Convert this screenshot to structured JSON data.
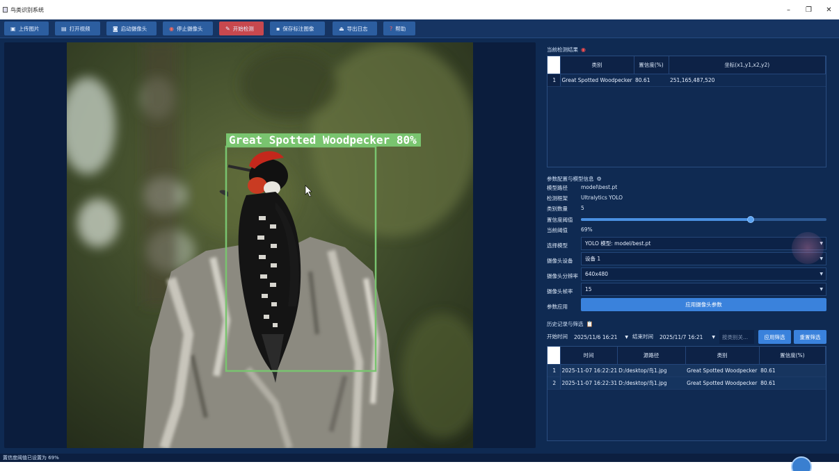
{
  "window": {
    "title": "鸟类识别系统",
    "controls": {
      "minimize": "–",
      "maximize": "❐",
      "close": "✕"
    }
  },
  "toolbar": {
    "buttons": [
      {
        "icon": "image-icon",
        "glyph": "▣",
        "label": "上传图片"
      },
      {
        "icon": "video-icon",
        "glyph": "▤",
        "label": "打开视频"
      },
      {
        "icon": "camera-icon",
        "glyph": "◙",
        "label": "启动摄像头"
      },
      {
        "icon": "stop-icon",
        "glyph": "◉",
        "label": "停止摄像头"
      },
      {
        "icon": "pen-icon",
        "glyph": "✎",
        "label": "开始检测"
      },
      {
        "icon": "save-icon",
        "glyph": "▪",
        "label": "保存标注图像"
      },
      {
        "icon": "export-icon",
        "glyph": "⏏",
        "label": "导出日志"
      },
      {
        "icon": "help-icon",
        "glyph": "?",
        "label": "帮助"
      }
    ]
  },
  "detection": {
    "label": "Great Spotted Woodpecker 80%"
  },
  "results": {
    "title": "当前检测结果",
    "icon": "target-icon",
    "columns": [
      "类别",
      "置信度(%)",
      "坐标(x1,y1,x2,y2)"
    ],
    "rows": [
      {
        "index": "1",
        "category": "Great Spotted Woodpecker",
        "confidence": "80.61",
        "coords": "251,165,487,520"
      }
    ]
  },
  "config": {
    "title": "参数配置与模型信息",
    "icon": "gear-icon",
    "model_path_label": "模型路径",
    "model_path": "model\\best.pt",
    "engine_label": "检测框架",
    "engine": "Ultralytics YOLO",
    "class_count_label": "类别数量",
    "class_count": "5",
    "threshold_label": "置信度阈值",
    "threshold_value": 0.69,
    "current_label": "当前阈值",
    "current_value": "69%",
    "model_select_label": "选择模型",
    "model_select_value": "YOLO 模型: model/best.pt",
    "camera_device_label": "摄像头设备",
    "camera_device_value": "设备 1",
    "resolution_label": "摄像头分辨率",
    "resolution_value": "640x480",
    "fps_label": "摄像头帧率",
    "fps_value": "15",
    "apply_label": "参数应用",
    "apply_button": "应用摄像头参数"
  },
  "history": {
    "title": "历史记录与筛选",
    "icon": "clipboard-icon",
    "start_label": "开始时间",
    "start_value": "2025/11/6 16:21",
    "end_label": "结束时间",
    "end_value": "2025/11/7 16:21",
    "search_placeholder": "按类别关...",
    "apply_filter": "应用筛选",
    "reset_filter": "重置筛选",
    "columns": [
      "时间",
      "源路径",
      "类别",
      "置信度(%)"
    ],
    "rows": [
      {
        "index": "1",
        "time": "2025-11-07 16:22:21",
        "path": "D:/desktop/鸟1.jpg",
        "category": "Great Spotted Woodpecker",
        "confidence": "80.61"
      },
      {
        "index": "2",
        "time": "2025-11-07 16:22:31",
        "path": "D:/desktop/鸟1.jpg",
        "category": "Great Spotted Woodpecker",
        "confidence": "80.61"
      }
    ]
  },
  "status": {
    "text": "置信度阈值已设置为 69%"
  }
}
